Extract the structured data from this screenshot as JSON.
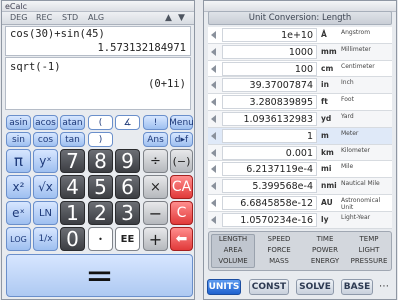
{
  "left": {
    "title": "eCalc",
    "menu": [
      "DEG",
      "REC",
      "STD",
      "ALG"
    ],
    "display": {
      "line1": "cos(30)+sin(45)",
      "result1": "1.573132184971",
      "line2": "sqrt(-1)",
      "result2": "(0+1i)"
    },
    "keys": {
      "asin": "asin",
      "acos": "acos",
      "atan": "atan",
      "paren": "(",
      "angle": "∡",
      "bang": "!",
      "menu": "Menu",
      "sin": "sin",
      "cos": "cos",
      "tan": "tan",
      "rparen": ")",
      "ans": "Ans",
      "dms": "d▸f",
      "pi": "π",
      "yx": "yˣ",
      "n7": "7",
      "n8": "8",
      "n9": "9",
      "div": "÷",
      "neg": "(−)",
      "x2": "x²",
      "sqrt": "√x",
      "n4": "4",
      "n5": "5",
      "n6": "6",
      "mul": "×",
      "ca": "CA",
      "ex": "eˣ",
      "ln": "LN",
      "n1": "1",
      "n2": "2",
      "n3": "3",
      "minus": "−",
      "c": "C",
      "log": "LOG",
      "inv": "1/x",
      "n0": "0",
      "dot": "•",
      "ee": "EE",
      "plus": "+",
      "back": "⬅",
      "equals": "="
    }
  },
  "right": {
    "title": "Unit Conversion: Length",
    "units": [
      {
        "value": "1e+10",
        "symbol": "Å",
        "name": "Angstrom"
      },
      {
        "value": "1000",
        "symbol": "mm",
        "name": "Millimeter"
      },
      {
        "value": "100",
        "symbol": "cm",
        "name": "Centimeter"
      },
      {
        "value": "39.37007874",
        "symbol": "in",
        "name": "Inch"
      },
      {
        "value": "3.280839895",
        "symbol": "ft",
        "name": "Foot"
      },
      {
        "value": "1.0936132983",
        "symbol": "yd",
        "name": "Yard"
      },
      {
        "value": "1",
        "symbol": "m",
        "name": "Meter"
      },
      {
        "value": "0.001",
        "symbol": "km",
        "name": "Kilometer"
      },
      {
        "value": "6.2137119e-4",
        "symbol": "mi",
        "name": "Mile"
      },
      {
        "value": "5.399568e-4",
        "symbol": "nmi",
        "name": "Nautical Mile"
      },
      {
        "value": "6.6845858e-12",
        "symbol": "AU",
        "name": "Astronomical Unit"
      },
      {
        "value": "1.0570234e-16",
        "symbol": "ly",
        "name": "Light-Year"
      }
    ],
    "categories": [
      "LENGTH",
      "SPEED",
      "TIME",
      "TEMP",
      "AREA",
      "FORCE",
      "POWER",
      "LIGHT",
      "VOLUME",
      "MASS",
      "ENERGY",
      "PRESSURE"
    ],
    "tabs": [
      "UNITS",
      "CONST",
      "SOLVE",
      "BASE"
    ]
  }
}
